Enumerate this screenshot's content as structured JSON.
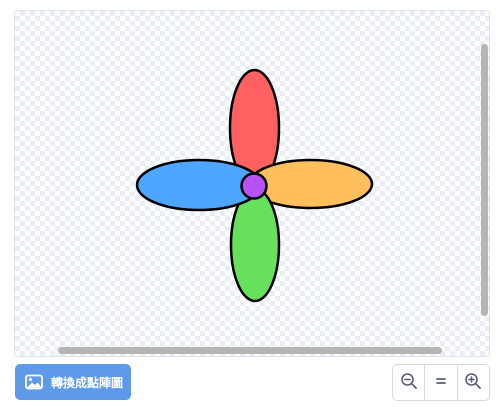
{
  "toolbar": {
    "convert_label": "轉換成點陣圖",
    "convert_icon": "image-icon",
    "zoom_out_icon": "zoom-out-icon",
    "zoom_reset_icon": "equals-icon",
    "zoom_in_icon": "zoom-in-icon"
  },
  "canvas": {
    "shapes": [
      {
        "name": "red-petal",
        "color": "#ff6163"
      },
      {
        "name": "orange-petal",
        "color": "#ffbf5c"
      },
      {
        "name": "green-petal",
        "color": "#67e05c"
      },
      {
        "name": "blue-petal",
        "color": "#4da6ff"
      },
      {
        "name": "purple-center",
        "color": "#b752f5"
      }
    ]
  },
  "colors": {
    "accent": "#5f9ae8",
    "scrollbar": "#b5b5b5"
  }
}
